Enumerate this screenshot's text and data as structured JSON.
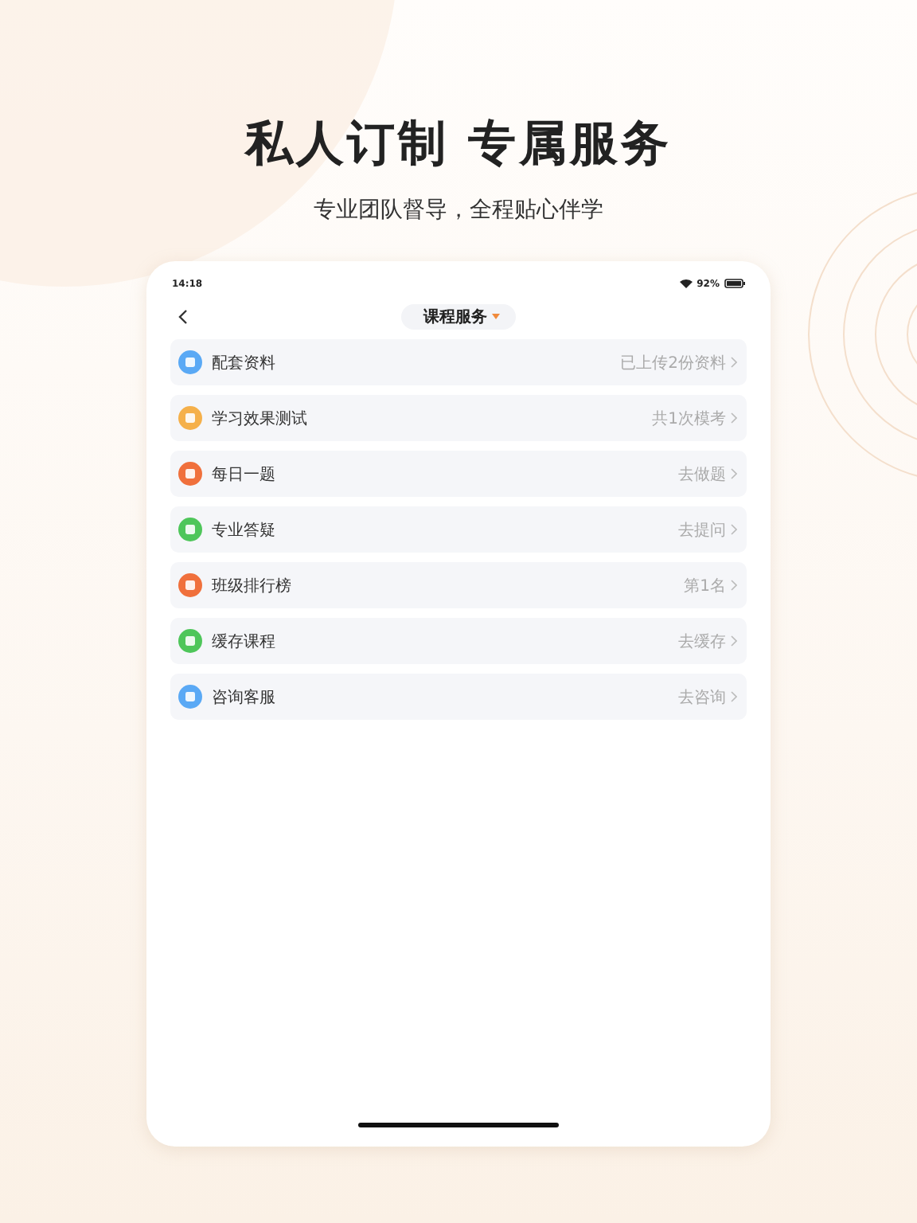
{
  "headline": "私人订制 专属服务",
  "subtitle": "专业团队督导，全程贴心伴学",
  "status_bar": {
    "time": "14:18",
    "battery": "92%"
  },
  "nav": {
    "title": "课程服务"
  },
  "items": [
    {
      "label": "配套资料",
      "detail": "已上传2份资料",
      "color": "#5aa9f5"
    },
    {
      "label": "学习效果测试",
      "detail": "共1次模考",
      "color": "#f5b04a"
    },
    {
      "label": "每日一题",
      "detail": "去做题",
      "color": "#f0703c"
    },
    {
      "label": "专业答疑",
      "detail": "去提问",
      "color": "#4ec65a"
    },
    {
      "label": "班级排行榜",
      "detail": "第1名",
      "color": "#f0703c"
    },
    {
      "label": "缓存课程",
      "detail": "去缓存",
      "color": "#4ec65a"
    },
    {
      "label": "咨询客服",
      "detail": "去咨询",
      "color": "#5aa9f5"
    }
  ]
}
